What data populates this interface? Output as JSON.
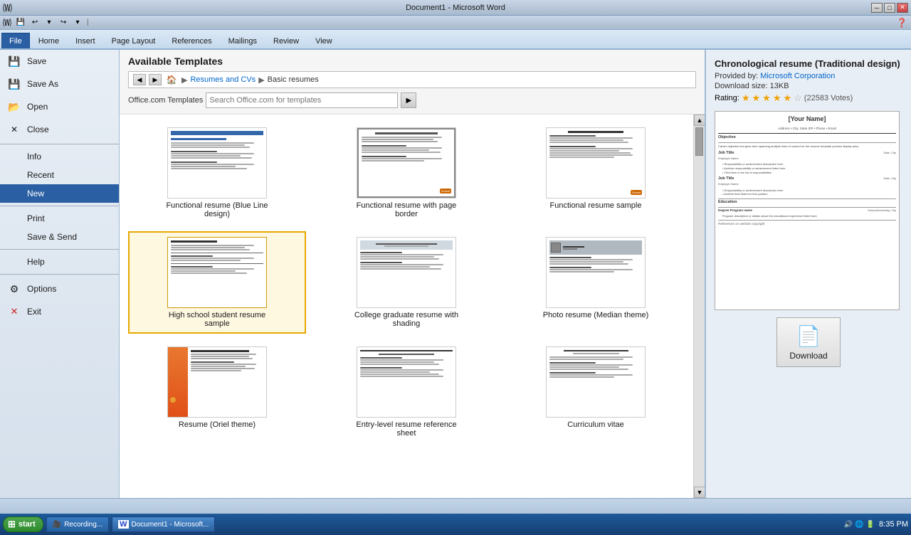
{
  "window": {
    "title": "Document1  -  Microsoft Word",
    "title_bar_buttons": [
      "minimize",
      "restore",
      "close"
    ]
  },
  "quick_access": {
    "buttons": [
      "save-qa",
      "undo",
      "undo-arrow",
      "redo",
      "customize"
    ]
  },
  "ribbon": {
    "tabs": [
      {
        "id": "file",
        "label": "File",
        "active": true
      },
      {
        "id": "home",
        "label": "Home"
      },
      {
        "id": "insert",
        "label": "Insert"
      },
      {
        "id": "page-layout",
        "label": "Page Layout"
      },
      {
        "id": "references",
        "label": "References"
      },
      {
        "id": "mailings",
        "label": "Mailings"
      },
      {
        "id": "review",
        "label": "Review"
      },
      {
        "id": "view",
        "label": "View"
      }
    ]
  },
  "sidebar": {
    "items": [
      {
        "id": "save",
        "label": "Save",
        "icon": "💾"
      },
      {
        "id": "save-as",
        "label": "Save As",
        "icon": "💾"
      },
      {
        "id": "open",
        "label": "Open",
        "icon": "📂"
      },
      {
        "id": "close",
        "label": "Close",
        "icon": "✕"
      },
      {
        "id": "info",
        "label": "Info",
        "active": false
      },
      {
        "id": "recent",
        "label": "Recent"
      },
      {
        "id": "new",
        "label": "New",
        "active": true
      },
      {
        "id": "print",
        "label": "Print"
      },
      {
        "id": "save-send",
        "label": "Save & Send"
      },
      {
        "id": "help",
        "label": "Help"
      },
      {
        "id": "options",
        "label": "Options",
        "icon": "⚙"
      },
      {
        "id": "exit",
        "label": "Exit",
        "icon": "✕"
      }
    ]
  },
  "content": {
    "title": "Available Templates",
    "breadcrumb": {
      "home": "Home",
      "separator1": "▶",
      "link1": "Resumes and CVs",
      "separator2": "▶",
      "current": "Basic resumes"
    },
    "search": {
      "placeholder": "Search Office.com for templates",
      "label": "Office.com Templates"
    },
    "templates": [
      {
        "id": "functional-blue",
        "name": "Functional resume (Blue Line design)",
        "style": "blue-line",
        "has_submit": false,
        "selected": false
      },
      {
        "id": "functional-border",
        "name": "Functional resume with page border",
        "style": "border",
        "has_submit": true,
        "selected": false
      },
      {
        "id": "functional-sample",
        "name": "Functional resume sample",
        "style": "plain",
        "has_submit": true,
        "selected": false
      },
      {
        "id": "high-school",
        "name": "High school student resume sample",
        "style": "plain2",
        "has_submit": false,
        "selected": true
      },
      {
        "id": "college-shading",
        "name": "College graduate resume with shading",
        "style": "shading",
        "has_submit": false,
        "selected": false
      },
      {
        "id": "photo-median",
        "name": "Photo resume (Median theme)",
        "style": "photo",
        "has_submit": false,
        "selected": false
      },
      {
        "id": "oriel",
        "name": "Resume (Oriel theme)",
        "style": "oriel",
        "has_submit": false,
        "selected": false
      },
      {
        "id": "entry-level",
        "name": "Entry-level resume reference sheet",
        "style": "entry",
        "has_submit": false,
        "selected": false
      },
      {
        "id": "curriculum",
        "name": "Curriculum vitae",
        "style": "cv",
        "has_submit": false,
        "selected": false
      }
    ]
  },
  "right_panel": {
    "title": "Chronological resume (Traditional design)",
    "provider_label": "Provided by: ",
    "provider": "Microsoft Corporation",
    "download_size_label": "Download size: ",
    "download_size": "13KB",
    "rating_label": "Rating: ",
    "stars": 4.5,
    "votes": "22583",
    "votes_label": "Votes",
    "download_button": "Download"
  },
  "status_bar": {
    "items": []
  },
  "taskbar": {
    "start_label": "start",
    "items": [
      {
        "label": "Recording...",
        "icon": "🎥"
      },
      {
        "label": "Document1 - Microsoft...",
        "icon": "W"
      }
    ],
    "time": "8:35 PM"
  }
}
